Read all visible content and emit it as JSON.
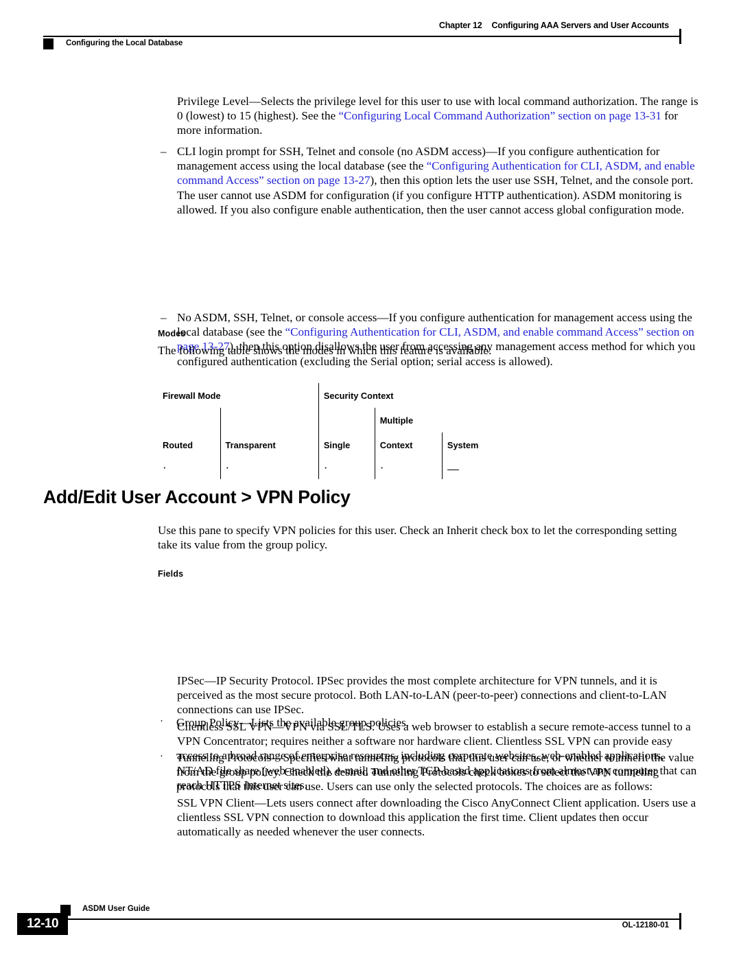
{
  "header": {
    "chapter_number": "Chapter 12",
    "chapter_title": "Configuring AAA Servers and User Accounts",
    "running_head": "Configuring the Local Database"
  },
  "body": {
    "privilege_level": {
      "run1": "Privilege Level—Selects the privilege level for this user to use with local command authorization. The range is 0 (lowest) to 15 (highest). See the ",
      "link": "“Configuring Local Command Authorization” section on page 13-31",
      "run2": " for more information."
    },
    "cli_login": {
      "dash": "–",
      "run1": "CLI login prompt for SSH, Telnet and console (no ASDM access)—If you configure authentication for management access using the local database (see the ",
      "link": "“Configuring Authentication for CLI, ASDM, and enable command Access” section on page 13-27",
      "run2": "), then this option lets the user use SSH, Telnet, and the console port. The user cannot use ASDM for configuration (if you configure HTTP authentication). ASDM monitoring is allowed. If you also configure enable authentication, then the user cannot access global configuration mode."
    },
    "no_access": {
      "dash": "–",
      "run1": "No ASDM, SSH, Telnet, or console access—If you configure authentication for management access using the local database (see the ",
      "link": "“Configuring Authentication for CLI, ASDM, and enable command Access” section on page 13-27",
      "run2": "), then this option disallows the user from accessing any management access method for which you configured authentication (excluding the Serial option; serial access is allowed)."
    },
    "modes_label": "Modes",
    "modes_intro": "The following table shows the modes in which this feature is available:",
    "section_heading": "Add/Edit User Account > VPN Policy",
    "vpn_intro": "Use this pane to specify VPN policies for this user. Check an Inherit check box to let the corresponding setting take its value from the group policy.",
    "fields_label": "Fields",
    "bullets": [
      {
        "marker": "·",
        "text": "Group Policy—Lists the available group policies."
      },
      {
        "marker": "·",
        "text": "Tunneling Protocols—Specifies what tunneling protocols that this user can use, or whether to inherit the value from the group policy. Check the desired Tunneling Protocols check boxes to select the VPN tunneling protocols that this user can use. Users can use only the selected protocols. The choices are as follows:"
      }
    ],
    "protocols": [
      "IPSec—IP Security Protocol. IPSec provides the most complete architecture for VPN tunnels, and it is perceived as the most secure protocol. Both LAN-to-LAN (peer-to-peer) connections and client-to-LAN connections can use IPSec.",
      "Clientless SSL VPN—VPN via SSL/TLS. Uses a web browser to establish a secure remote-access tunnel to a VPN Concentrator; requires neither a software nor hardware client. Clientless SSL VPN can provide easy access to a broad range of enterprise resources, including corporate websites, web-enabled applications, NT/AD file share (web-enabled), e-mail, and other TCP-based applications from almost any computer that can reach HTTPS Internet sites.",
      "SSL VPN Client—Lets users connect after downloading the Cisco AnyConnect Client application. Users use a clientless SSL VPN connection to download this application the first time. Client updates then occur automatically as needed whenever the user connects."
    ]
  },
  "modes_table": {
    "group_headers": {
      "firewall_mode": "Firewall Mode",
      "security_context": "Security Context",
      "multiple": "Multiple"
    },
    "column_headers": {
      "routed": "Routed",
      "transparent": "Transparent",
      "single": "Single",
      "context": "Context",
      "system": "System"
    },
    "values": {
      "routed": "·",
      "transparent": "·",
      "single": "·",
      "context": "·",
      "system": "—"
    }
  },
  "footer": {
    "page_number": "12-10",
    "guide_title": "ASDM User Guide",
    "doc_id": "OL-12180-01"
  },
  "colors": {
    "link": "#2424d8",
    "text": "#000000",
    "background": "#ffffff"
  }
}
